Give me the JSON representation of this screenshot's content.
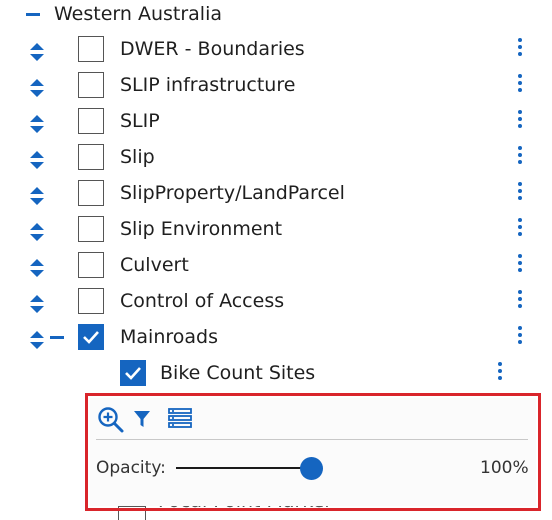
{
  "group": {
    "title": "Western Australia"
  },
  "layers": [
    {
      "label": "DWER - Boundaries",
      "checked": false
    },
    {
      "label": "SLIP infrastructure",
      "checked": false
    },
    {
      "label": "SLIP",
      "checked": false
    },
    {
      "label": "Slip",
      "checked": false
    },
    {
      "label": "SlipProperty/LandParcel",
      "checked": false
    },
    {
      "label": "Slip Environment",
      "checked": false
    },
    {
      "label": "Culvert",
      "checked": false
    },
    {
      "label": "Control of Access",
      "checked": false
    },
    {
      "label": "Mainroads",
      "checked": true
    }
  ],
  "sublayer": {
    "label": "Bike Count Sites",
    "checked": true
  },
  "panel": {
    "opacity_label": "Opacity:",
    "opacity_value": "100%",
    "opacity_fraction": 1.0
  },
  "partial_next": {
    "label": "Focal Point Marker"
  },
  "colors": {
    "accent": "#1565c0",
    "highlight_border": "#d9252b"
  }
}
